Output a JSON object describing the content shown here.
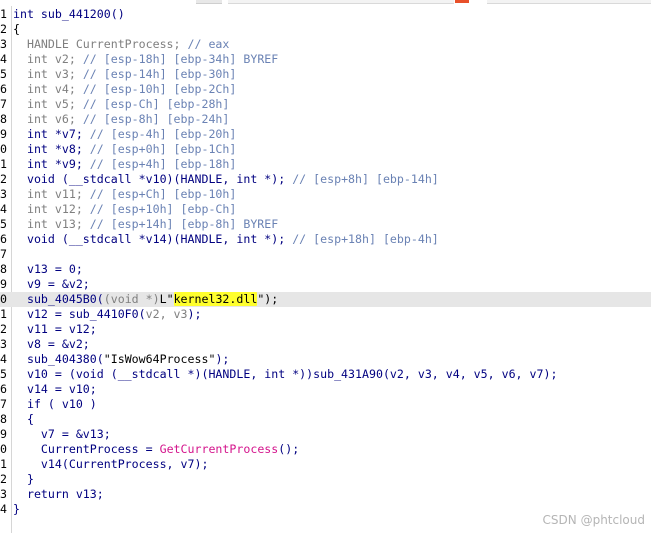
{
  "lines": [
    {
      "n": "1",
      "t": [
        [
          "int sub_441200()",
          "c-navy"
        ]
      ]
    },
    {
      "n": "2",
      "t": [
        [
          "{",
          ""
        ]
      ]
    },
    {
      "n": "3",
      "t": [
        [
          "  HANDLE CurrentProcess; ",
          "c-gray"
        ],
        [
          "// eax",
          "c-cmt"
        ]
      ]
    },
    {
      "n": "4",
      "t": [
        [
          "  int v2; ",
          "c-gray"
        ],
        [
          "// [esp-18h] [ebp-34h] BYREF",
          "c-cmt"
        ]
      ]
    },
    {
      "n": "5",
      "t": [
        [
          "  int v3; ",
          "c-gray"
        ],
        [
          "// [esp-14h] [ebp-30h]",
          "c-cmt"
        ]
      ]
    },
    {
      "n": "6",
      "t": [
        [
          "  int v4; ",
          "c-gray"
        ],
        [
          "// [esp-10h] [ebp-2Ch]",
          "c-cmt"
        ]
      ]
    },
    {
      "n": "7",
      "t": [
        [
          "  int v5; ",
          "c-gray"
        ],
        [
          "// [esp-Ch] [ebp-28h]",
          "c-cmt"
        ]
      ]
    },
    {
      "n": "8",
      "t": [
        [
          "  int v6; ",
          "c-gray"
        ],
        [
          "// [esp-8h] [ebp-24h]",
          "c-cmt"
        ]
      ]
    },
    {
      "n": "9",
      "t": [
        [
          "  int *v7; ",
          "c-navy"
        ],
        [
          "// [esp-4h] [ebp-20h]",
          "c-cmt"
        ]
      ]
    },
    {
      "n": "0",
      "t": [
        [
          "  int *v8; ",
          "c-navy"
        ],
        [
          "// [esp+0h] [ebp-1Ch]",
          "c-cmt"
        ]
      ]
    },
    {
      "n": "1",
      "t": [
        [
          "  int *v9; ",
          "c-navy"
        ],
        [
          "// [esp+4h] [ebp-18h]",
          "c-cmt"
        ]
      ]
    },
    {
      "n": "2",
      "t": [
        [
          "  void (__stdcall *v10)(HANDLE, int *); ",
          "c-navy"
        ],
        [
          "// [esp+8h] [ebp-14h]",
          "c-cmt"
        ]
      ]
    },
    {
      "n": "3",
      "t": [
        [
          "  int v11; ",
          "c-gray"
        ],
        [
          "// [esp+Ch] [ebp-10h]",
          "c-cmt"
        ]
      ]
    },
    {
      "n": "4",
      "t": [
        [
          "  int v12; ",
          "c-gray"
        ],
        [
          "// [esp+10h] [ebp-Ch]",
          "c-cmt"
        ]
      ]
    },
    {
      "n": "5",
      "t": [
        [
          "  int v13; ",
          "c-gray"
        ],
        [
          "// [esp+14h] [ebp-8h] BYREF",
          "c-cmt"
        ]
      ]
    },
    {
      "n": "6",
      "t": [
        [
          "  void (__stdcall *v14)(HANDLE, int *); ",
          "c-navy"
        ],
        [
          "// [esp+18h] [ebp-4h]",
          "c-cmt"
        ]
      ]
    },
    {
      "n": "7",
      "t": []
    },
    {
      "n": "8",
      "t": [
        [
          "  v13 = 0;",
          "c-navy"
        ]
      ]
    },
    {
      "n": "9",
      "t": [
        [
          "  v9 = &v2;",
          "c-navy"
        ]
      ]
    },
    {
      "n": "0",
      "current": true,
      "t": [
        [
          "  sub_4045B0(",
          "c-navy"
        ],
        [
          "(void *)",
          "c-gray"
        ],
        [
          "L\"",
          "c-str"
        ],
        [
          "kernel32.dll",
          "hl"
        ],
        [
          "\");",
          "c-str"
        ]
      ]
    },
    {
      "n": "1",
      "t": [
        [
          "  v12 = sub_4410F0(",
          "c-navy"
        ],
        [
          "v2, v3",
          "c-gray"
        ],
        [
          ");",
          "c-navy"
        ]
      ]
    },
    {
      "n": "2",
      "t": [
        [
          "  v11 = v12;",
          "c-navy"
        ]
      ]
    },
    {
      "n": "3",
      "t": [
        [
          "  v8 = &v2;",
          "c-navy"
        ]
      ]
    },
    {
      "n": "4",
      "t": [
        [
          "  sub_404380(",
          "c-navy"
        ],
        [
          "\"IsWow64Process\"",
          "c-str"
        ],
        [
          ");",
          "c-navy"
        ]
      ]
    },
    {
      "n": "5",
      "t": [
        [
          "  v10 = (void (__stdcall *)(HANDLE, int *))sub_431A90(v2, v3, v4, v5, v6, v7);",
          "c-navy"
        ]
      ]
    },
    {
      "n": "6",
      "t": [
        [
          "  v14 = v10;",
          "c-navy"
        ]
      ]
    },
    {
      "n": "7",
      "t": [
        [
          "  if ( v10 )",
          "c-navy"
        ]
      ]
    },
    {
      "n": "8",
      "t": [
        [
          "  {",
          "c-navy"
        ]
      ]
    },
    {
      "n": "9",
      "t": [
        [
          "    v7 = &v13;",
          "c-navy"
        ]
      ]
    },
    {
      "n": "0",
      "t": [
        [
          "    CurrentProcess = ",
          "c-navy"
        ],
        [
          "GetCurrentProcess",
          "c-mag"
        ],
        [
          "();",
          "c-navy"
        ]
      ]
    },
    {
      "n": "1",
      "t": [
        [
          "    v14(CurrentProcess, v7);",
          "c-navy"
        ]
      ]
    },
    {
      "n": "2",
      "t": [
        [
          "  }",
          "c-navy"
        ]
      ]
    },
    {
      "n": "3",
      "t": [
        [
          "  return v13;",
          "c-navy"
        ]
      ]
    },
    {
      "n": "4",
      "t": [
        [
          "}",
          "c-navy"
        ]
      ]
    }
  ],
  "watermark": "CSDN @phtcloud"
}
